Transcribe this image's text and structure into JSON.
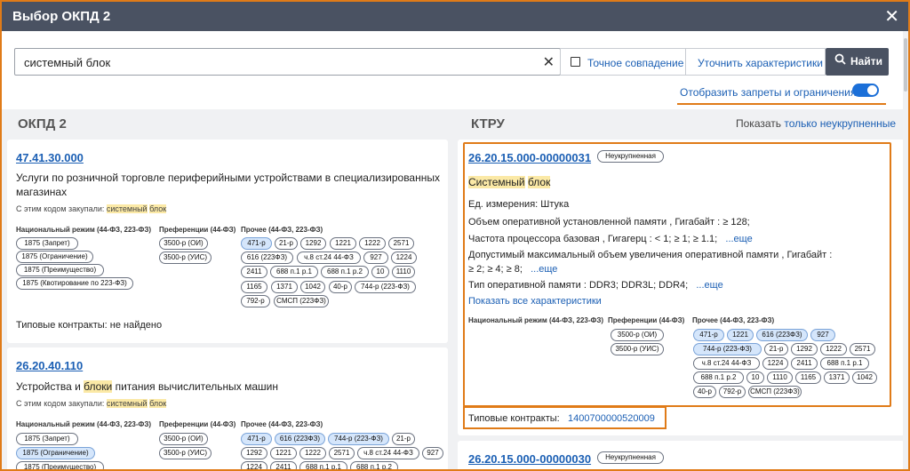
{
  "dialog": {
    "title": "Выбор ОКПД 2",
    "close": "✕"
  },
  "search": {
    "value": "системный блок",
    "clear": "✕",
    "exact_label": "Точное совпадение",
    "refine_label": "Уточнить характеристики",
    "find_icon": "🔍",
    "find_label": "Найти"
  },
  "bans": {
    "label": "Отобразить запреты и ограничения",
    "on": true
  },
  "okpd": {
    "heading": "ОКПД 2",
    "items": [
      {
        "code": "47.41.30.000",
        "desc1": "Услуги по розничной торговле периферийными устройствами в специализированных",
        "desc2": "магазинах",
        "bought": "С этим кодом закупали:",
        "b1": "системный",
        "b2": "блок",
        "col1": "Национальный режим (44-ФЗ, 223-ФЗ)",
        "col2": "Преференции (44-ФЗ)",
        "col3": "Прочее (44-ФЗ, 223-ФЗ)",
        "nat": [
          "1875 (Запрет)",
          "1875 (Ограничение)",
          "1875 (Преимущество)",
          "1875 (Квотирование по 223-ФЗ)"
        ],
        "pref": [
          "3500-р (ОИ)",
          "3500-р (УИС)"
        ],
        "other": [
          "471-р",
          "21-р",
          "1292",
          "1221",
          "1222",
          "2571",
          "616 (223ФЗ)",
          "ч.8 ст.24 44-ФЗ",
          "927",
          "1224",
          "2411",
          "688 п.1 р.1",
          "688 п.1 р.2",
          "10",
          "1110",
          "1165",
          "1371",
          "1042",
          "40-р",
          "744-р (223-ФЗ)",
          "792-р",
          "СМСП (223ФЗ)"
        ],
        "tc_label": "Типовые контракты:",
        "tc_value": "не найдено"
      },
      {
        "code": "26.20.40.110",
        "desc_a": "Устройства и ",
        "desc_b": "блоки",
        "desc_c": " питания вычислительных машин",
        "bought": "С этим кодом закупали:",
        "b1": "системный",
        "b2": "блок",
        "col1": "Национальный режим (44-ФЗ, 223-ФЗ)",
        "col2": "Преференции (44-ФЗ)",
        "col3": "Прочее (44-ФЗ, 223-ФЗ)",
        "nat": [
          "1875 (Запрет)",
          "1875 (Ограничение)",
          "1875 (Преимущество)"
        ],
        "pref": [
          "3500-р (ОИ)",
          "3500-р (УИС)"
        ],
        "other": [
          "471-р",
          "616 (223ФЗ)",
          "744-р (223-ФЗ)",
          "21-р",
          "1292",
          "1221",
          "1222",
          "2571",
          "ч.8 ст.24 44-ФЗ",
          "927",
          "1224",
          "2411",
          "688 п.1 р.1",
          "688 п.1 р.2"
        ]
      }
    ]
  },
  "ktru": {
    "heading": "КТРУ",
    "show_label": "Показать",
    "show_link": "только неукрупненные",
    "items": [
      {
        "code": "26.20.15.000-00000031",
        "badge": "Неукрупненная",
        "n1": "Системный",
        "n2": "блок",
        "unit_label": "Ед. измерения:",
        "unit": "Штука",
        "ram": "Объем оперативной установленной памяти , Гигабайт : ≥ 128;",
        "cpu": "Частота процессора базовая , Гигагерц : < 1;  ≥ 1;  ≥ 1.1;",
        "cpu_more": "...еще",
        "maxram1": "Допустимый максимальный объем увеличения оперативной памяти , Гигабайт :",
        "maxram2": "≥ 2;  ≥ 4;  ≥ 8;",
        "maxram_more": "...еще",
        "type": "Тип оперативной памяти : DDR3;  DDR3L;  DDR4;",
        "type_more": "...еще",
        "showall": "Показать все характеристики",
        "col1": "Национальный режим (44-ФЗ, 223-ФЗ)",
        "col2": "Преференции (44-ФЗ)",
        "col3": "Прочее (44-ФЗ, 223-ФЗ)",
        "pref": [
          "3500-р (ОИ)",
          "3500-р (УИС)"
        ],
        "other": [
          "471-р",
          "1221",
          "616 (223ФЗ)",
          "927",
          "744-р (223-ФЗ)",
          "21-р",
          "1292",
          "1222",
          "2571",
          "ч.8 ст.24 44-ФЗ",
          "1224",
          "2411",
          "688 п.1 р.1",
          "688 п.1 р.2",
          "10",
          "1110",
          "1165",
          "1371",
          "1042",
          "40-р",
          "792-р",
          "СМСП (223ФЗ)"
        ],
        "tc_label": "Типовые контракты:",
        "tc_value": "1400700000520009"
      },
      {
        "code": "26.20.15.000-00000030",
        "badge": "Неукрупненная"
      }
    ]
  },
  "colors": {
    "accent": "#1b5fb4",
    "header": "#4a5262",
    "highlight": "#e07b18"
  }
}
